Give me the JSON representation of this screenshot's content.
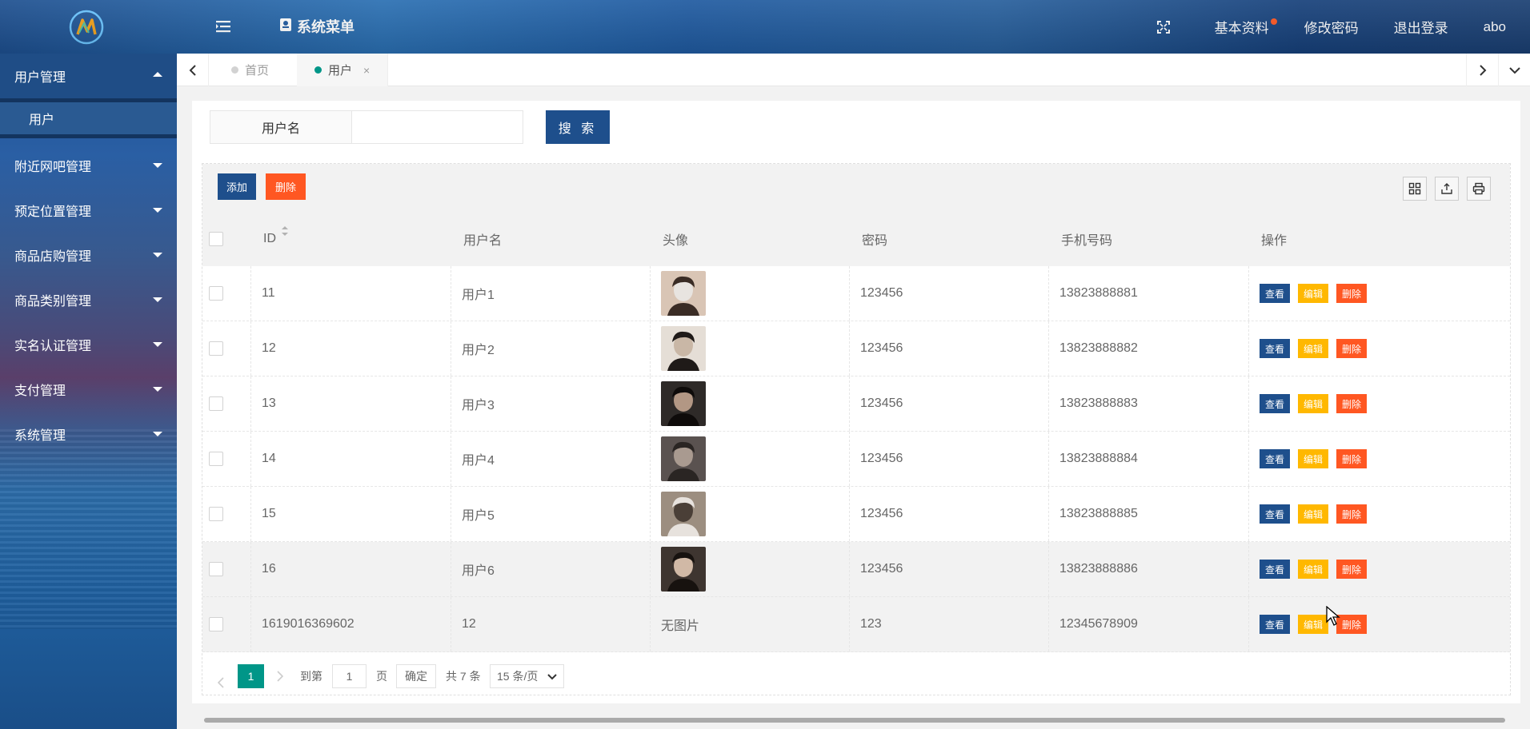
{
  "header": {
    "menu_title": "系统菜单",
    "right_items": {
      "profile": "基本资料",
      "change_password": "修改密码",
      "logout": "退出登录",
      "user": "abo"
    }
  },
  "sidebar": {
    "group_user": "用户管理",
    "sub_user": "用户",
    "items": [
      "附近网吧管理",
      "预定位置管理",
      "商品店购管理",
      "商品类别管理",
      "实名认证管理",
      "支付管理",
      "系统管理"
    ]
  },
  "tabs": {
    "home": "首页",
    "user": "用户",
    "close": "×"
  },
  "search": {
    "label": "用户名",
    "value": "",
    "button": "搜 索"
  },
  "toolbar": {
    "add": "添加",
    "delete": "删除"
  },
  "table": {
    "headers": [
      "ID",
      "用户名",
      "头像",
      "密码",
      "手机号码",
      "操作"
    ],
    "rows": [
      {
        "id": "11",
        "username": "用户1",
        "avatar": "image",
        "password": "123456",
        "phone": "13823888881"
      },
      {
        "id": "12",
        "username": "用户2",
        "avatar": "image",
        "password": "123456",
        "phone": "13823888882"
      },
      {
        "id": "13",
        "username": "用户3",
        "avatar": "image",
        "password": "123456",
        "phone": "13823888883"
      },
      {
        "id": "14",
        "username": "用户4",
        "avatar": "image",
        "password": "123456",
        "phone": "13823888884"
      },
      {
        "id": "15",
        "username": "用户5",
        "avatar": "image",
        "password": "123456",
        "phone": "13823888885"
      },
      {
        "id": "16",
        "username": "用户6",
        "avatar": "image",
        "password": "123456",
        "phone": "13823888886"
      },
      {
        "id": "1619016369602",
        "username": "12",
        "avatar": "无图片",
        "password": "123",
        "phone": "12345678909"
      }
    ],
    "actions": {
      "view": "查看",
      "edit": "编辑",
      "delete": "删除"
    }
  },
  "pager": {
    "current": "1",
    "goto": "到第",
    "page_input": "1",
    "page_unit": "页",
    "confirm": "确定",
    "total": "共 7 条",
    "per_page": "15 条/页"
  },
  "colors": {
    "primary": "#1e4f8c",
    "danger": "#ff5722",
    "warning": "#ffb800",
    "teal": "#009688"
  }
}
